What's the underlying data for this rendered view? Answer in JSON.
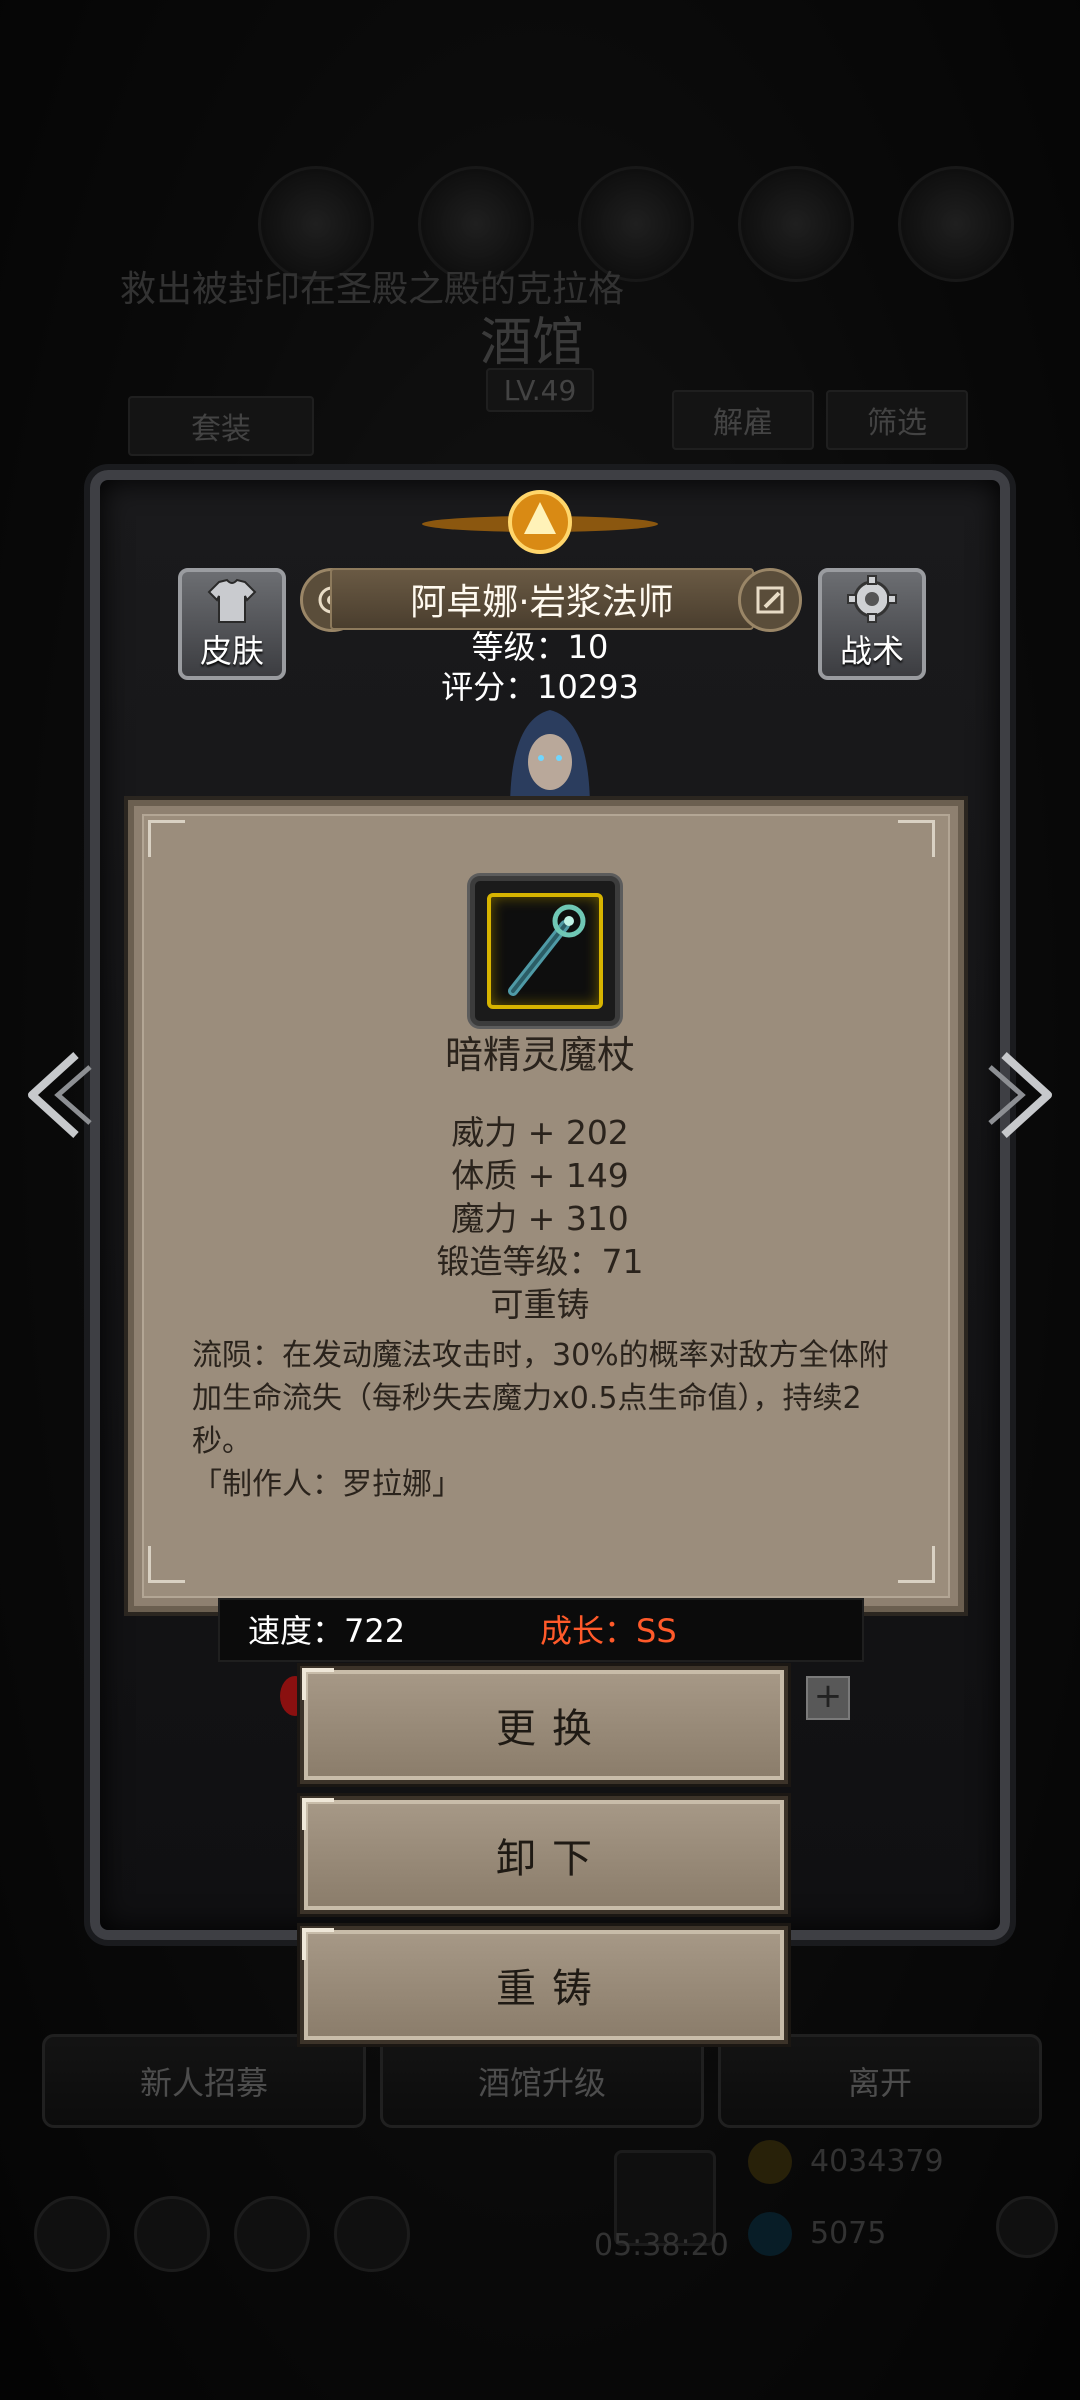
{
  "background": {
    "title": "酒馆",
    "level": "LV.49",
    "quest_text": "救出被封印在圣殿之殿的克拉格",
    "top_tabs": [
      "套装",
      "解雇",
      "筛选"
    ],
    "bottom_buttons": [
      "新人招募",
      "酒馆升级",
      "离开"
    ],
    "currency_gold": "4034379",
    "currency_gem": "5075",
    "timer": "05:38:20"
  },
  "hero": {
    "name": "阿卓娜·岩浆法师",
    "level_line": "等级：10",
    "score_line": "评分：10293",
    "skin_button": "皮肤",
    "tactics_button": "战术",
    "speed_line": "速度：722",
    "growth_line": "成长：SS"
  },
  "item": {
    "icon": "staff-icon",
    "name": "暗精灵魔杖",
    "stats": [
      "威力 + 202",
      "体质 + 149",
      "魔力 + 310",
      "锻造等级：71",
      "可重铸"
    ],
    "description": "流陨：在发动魔法攻击时，30%的概率对敌方全体附加生命流失（每秒失去魔力x0.5点生命值），持续2秒。",
    "maker": "「制作人：罗拉娜」"
  },
  "actions": {
    "replace": "更换",
    "unequip": "卸下",
    "reforge": "重铸"
  },
  "colors": {
    "card_bg": "#9b8d7c",
    "growth_accent": "#ff5a2a",
    "item_frame_gold": "#d7b400"
  }
}
